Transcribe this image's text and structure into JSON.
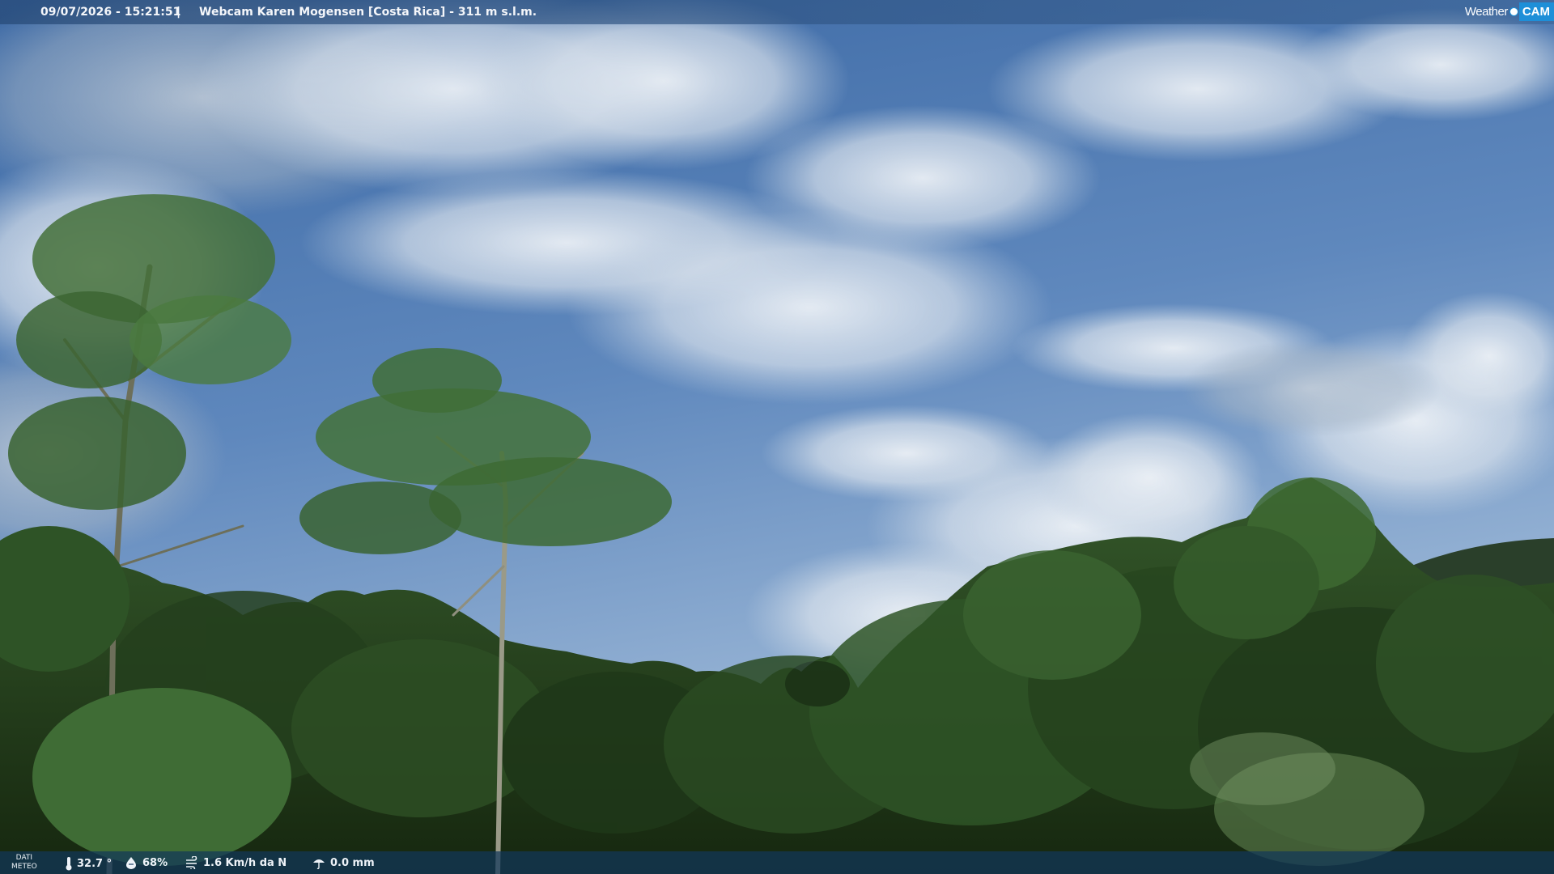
{
  "overlay": {
    "datetime": "09/07/2026 - 15:21:51",
    "separator": "|",
    "caption": "Webcam Karen Mogensen [Costa Rica] - 311 m s.l.m."
  },
  "logo": {
    "weather": "Weather",
    "cam": "CAM"
  },
  "weather_data": {
    "label_line1": "DATI",
    "label_line2": "METEO",
    "temperature": "32.7 °",
    "humidity": "68%",
    "wind": "1.6 Km/h da N",
    "rain": "0.0 mm",
    "icons": {
      "temperature": "thermometer-icon",
      "humidity": "humidity-drop-icon",
      "wind": "wind-icon",
      "rain": "rain-icon"
    }
  },
  "colors": {
    "sky_top": "#3a6aa8",
    "sky_bottom": "#8fb0d6",
    "cloud": "#eef2f6",
    "foliage_dark": "#1f3a1c",
    "foliage_mid": "#2f5a28",
    "foliage_light": "#5f8a48",
    "overlay_bar": "#12375a",
    "logo_blue": "#1e8fd8"
  }
}
